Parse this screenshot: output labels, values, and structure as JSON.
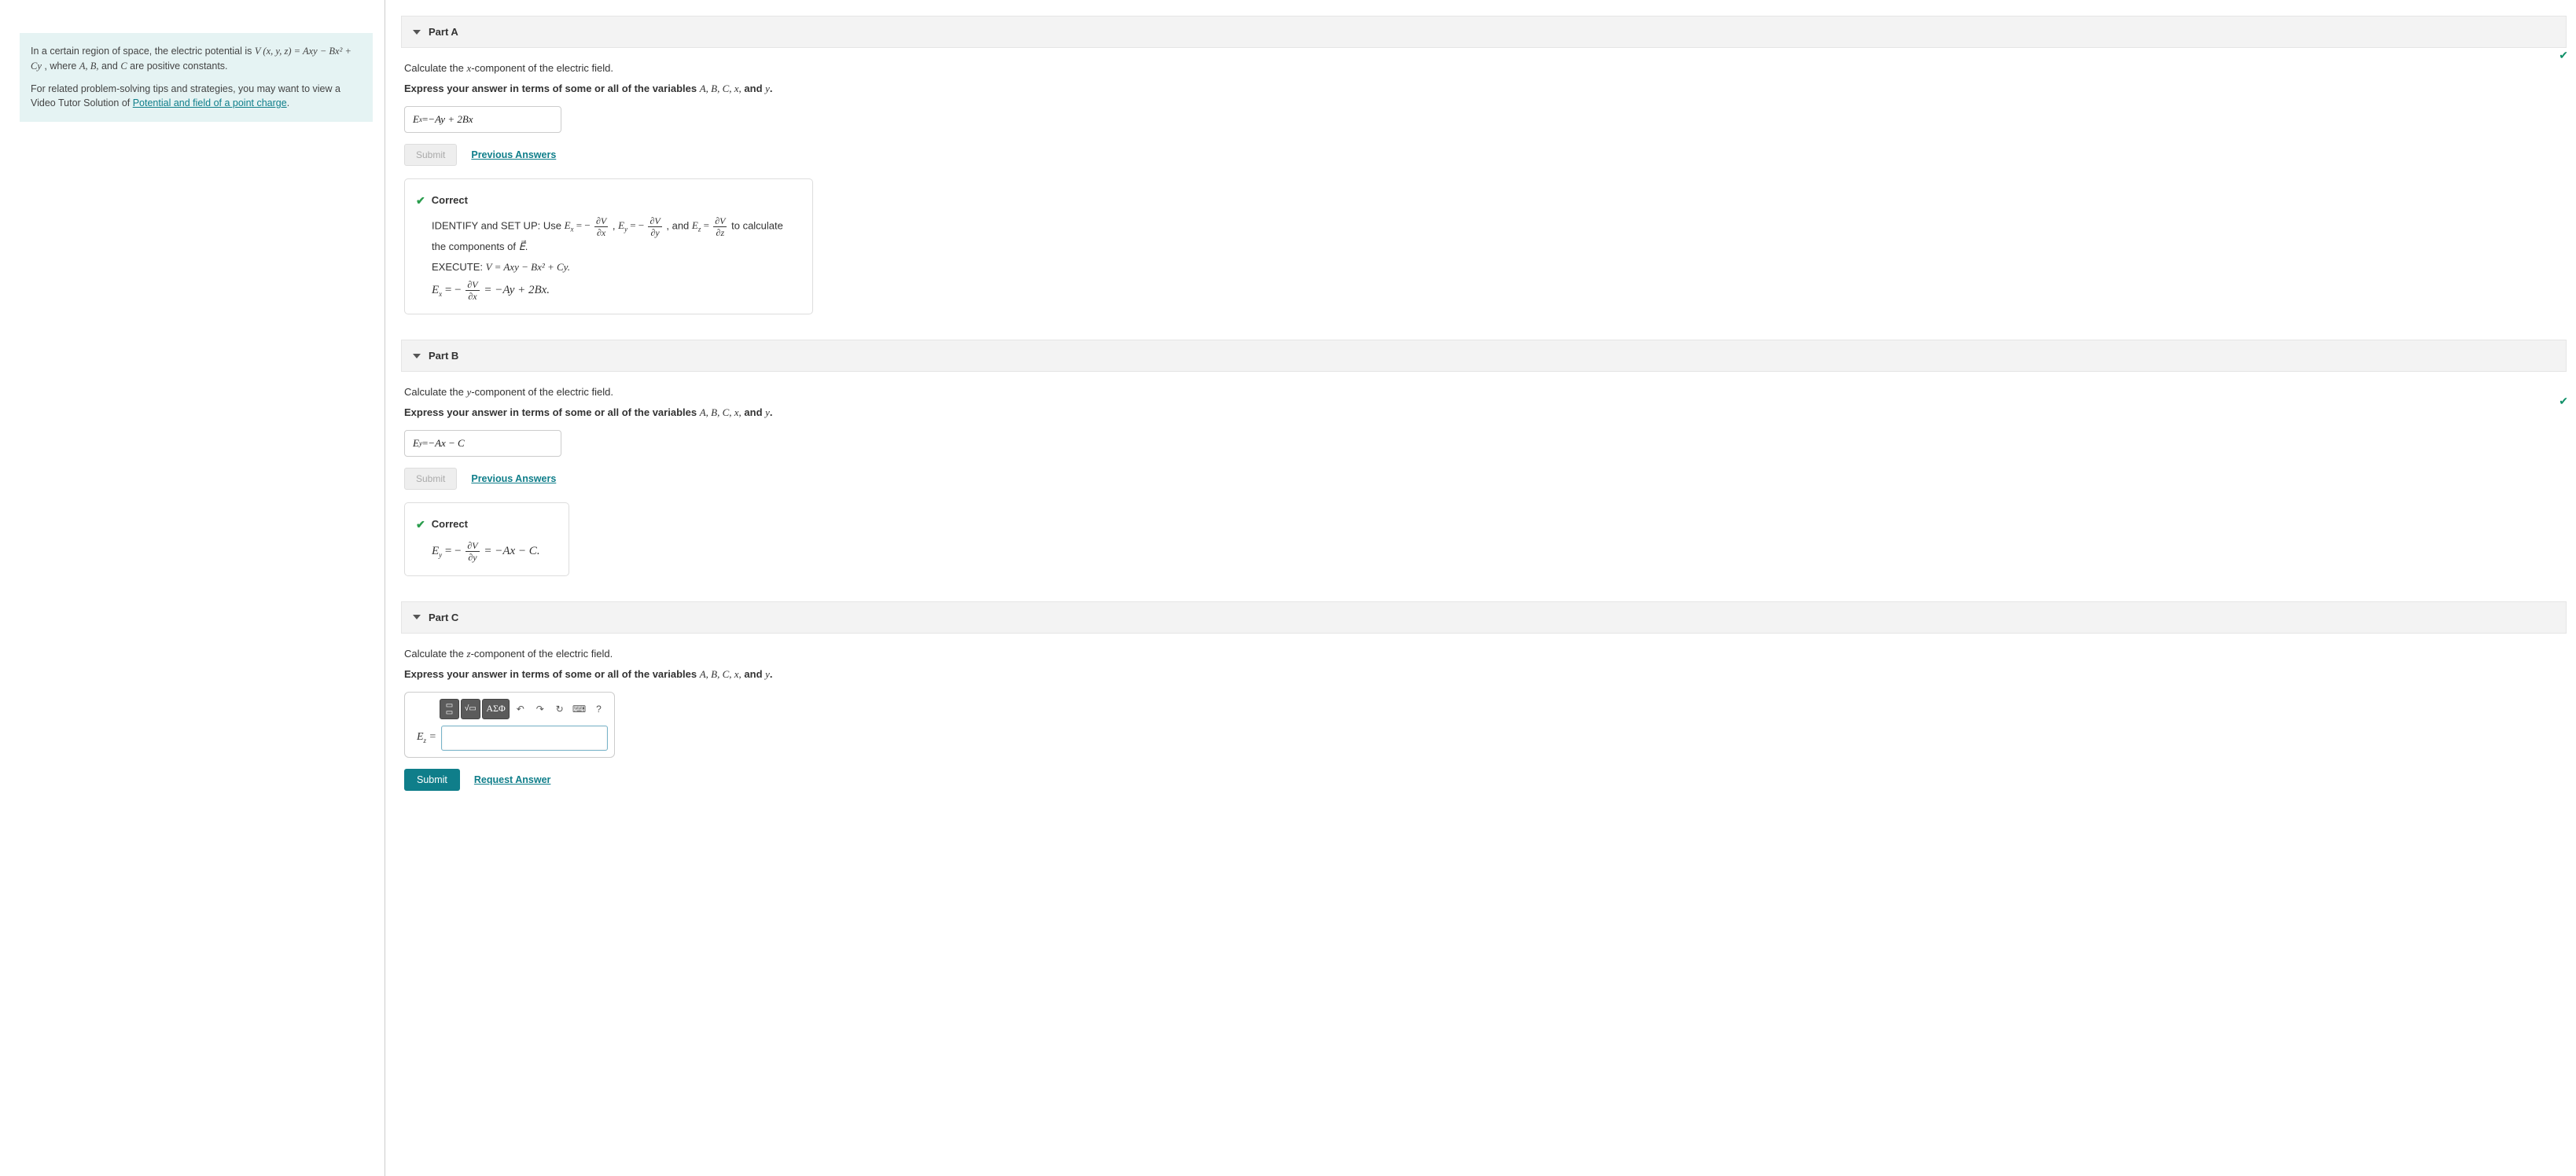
{
  "problem": {
    "text_before_eq": "In a certain region of space, the electric potential is ",
    "equation": "V (x, y, z) = Axy − Bx² + Cy",
    "text_after_eq": ", where ",
    "vars": "A, B,",
    "text_and": " and ",
    "var_c": "C",
    "text_const": " are positive constants.",
    "related_1": "For related problem-solving tips and strategies, you may want to view a Video Tutor Solution of ",
    "related_link": "Potential and field of a point charge",
    "related_end": "."
  },
  "partA": {
    "title": "Part A",
    "prompt_before": "Calculate the ",
    "prompt_var": "x",
    "prompt_after": "-component of the electric field.",
    "express_before": "Express your answer in terms of some or all of the variables ",
    "express_vars": "A, B, C, x,",
    "express_and": " and ",
    "express_y": "y",
    "express_end": ".",
    "answer_lhs": "E",
    "answer_sub": "x",
    "answer_eq": " = ",
    "answer_rhs": "−Ay + 2Bx",
    "submit": "Submit",
    "prev": "Previous Answers",
    "correct": "Correct",
    "fb1_a": "IDENTIFY and SET UP: Use ",
    "fb1_b": " , and ",
    "fb1_c": " to calculate the components of ",
    "fb2_a": "EXECUTE: ",
    "fb2_eq": "V = Axy − Bx² + Cy.",
    "fb3_eq": " = −Ay + 2Bx."
  },
  "partB": {
    "title": "Part B",
    "prompt_before": "Calculate the ",
    "prompt_var": "y",
    "prompt_after": "-component of the electric field.",
    "answer_lhs": "E",
    "answer_sub": "y",
    "answer_eq": " = ",
    "answer_rhs": "−Ax − C",
    "submit": "Submit",
    "prev": "Previous Answers",
    "correct": "Correct",
    "fb_eq": " = −Ax − C."
  },
  "partC": {
    "title": "Part C",
    "prompt_before": "Calculate the ",
    "prompt_var": "z",
    "prompt_after": "-component of the electric field.",
    "express_before": "Express your answer in terms of some or all of the variables ",
    "express_vars": "A, B, C, x,",
    "express_and": " and ",
    "express_y": "y",
    "express_end": ".",
    "tool_greek": "ΑΣΦ",
    "tool_undo": "↶",
    "tool_redo": "↷",
    "tool_reset": "↻",
    "tool_kbd": "⌨",
    "tool_help": "?",
    "lhs": "E",
    "lhs_sub": "z",
    "eq": " = ",
    "submit": "Submit",
    "request": "Request Answer"
  },
  "shared": {
    "express_before": "Express your answer in terms of some or all of the variables ",
    "express_vars": "A, B, C, x,",
    "express_and": " and ",
    "express_y": "y",
    "express_end": "."
  }
}
